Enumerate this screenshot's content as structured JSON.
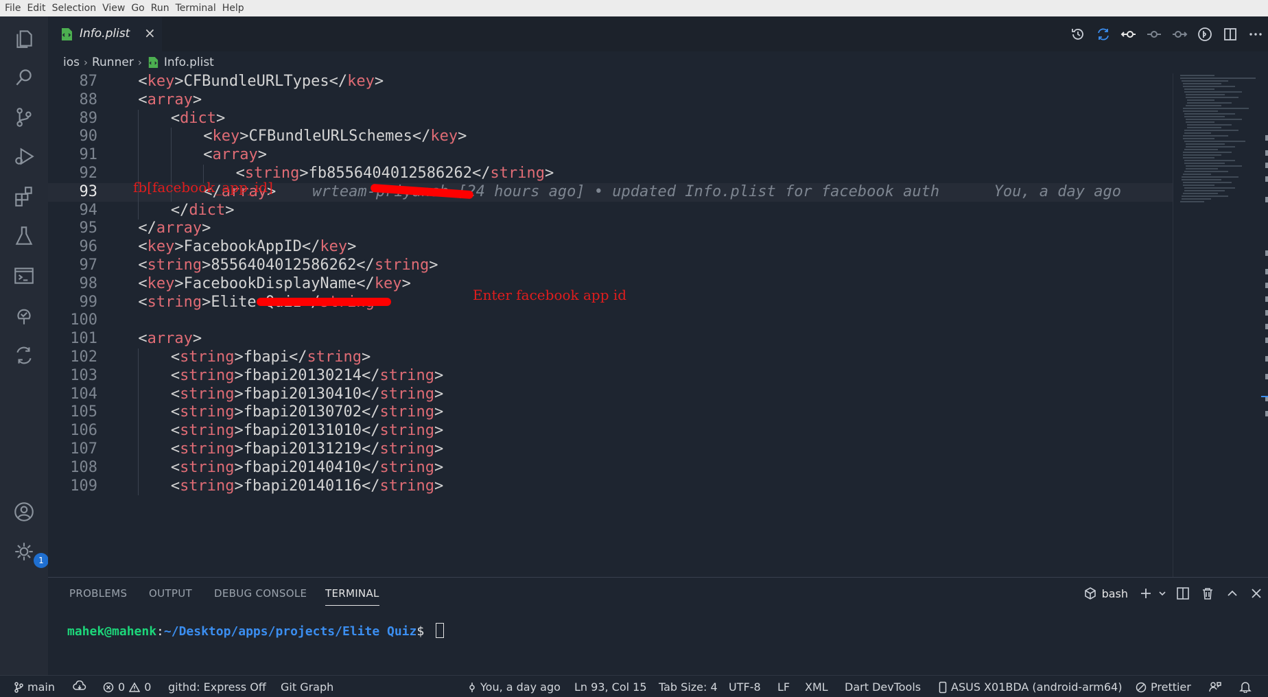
{
  "menu": [
    "File",
    "Edit",
    "Selection",
    "View",
    "Go",
    "Run",
    "Terminal",
    "Help"
  ],
  "tab": {
    "label": "Info.plist",
    "close": "×"
  },
  "breadcrumb": {
    "parts": [
      "ios",
      "Runner",
      "Info.plist"
    ]
  },
  "editor": {
    "lines": [
      {
        "n": "87",
        "indent": 1,
        "code": [
          [
            "t",
            "<"
          ],
          [
            "k",
            "key"
          ],
          [
            "t",
            ">CFBundleURLTypes</"
          ],
          [
            "k",
            "key"
          ],
          [
            "t",
            ">"
          ]
        ]
      },
      {
        "n": "88",
        "indent": 1,
        "code": [
          [
            "t",
            "<"
          ],
          [
            "k",
            "array"
          ],
          [
            "t",
            ">"
          ]
        ]
      },
      {
        "n": "89",
        "indent": 2,
        "code": [
          [
            "t",
            "<"
          ],
          [
            "k",
            "dict"
          ],
          [
            "t",
            ">"
          ]
        ]
      },
      {
        "n": "90",
        "indent": 3,
        "code": [
          [
            "t",
            "<"
          ],
          [
            "k",
            "key"
          ],
          [
            "t",
            ">CFBundleURLSchemes</"
          ],
          [
            "k",
            "key"
          ],
          [
            "t",
            ">"
          ]
        ]
      },
      {
        "n": "91",
        "indent": 3,
        "code": [
          [
            "t",
            "<"
          ],
          [
            "k",
            "array"
          ],
          [
            "t",
            ">"
          ]
        ]
      },
      {
        "n": "92",
        "indent": 4,
        "code": [
          [
            "t",
            "<"
          ],
          [
            "k",
            "string"
          ],
          [
            "t",
            ">fb8556404012586262</"
          ],
          [
            "k",
            "string"
          ],
          [
            "t",
            ">"
          ]
        ]
      },
      {
        "n": "93",
        "indent": 3,
        "current": true,
        "code": [
          [
            "t",
            "</"
          ],
          [
            "k",
            "array"
          ],
          [
            "t",
            ">"
          ]
        ],
        "blame": "    wrteam-priyansh [24 hours ago] • updated Info.plist for facebook auth      You, a day ago"
      },
      {
        "n": "94",
        "indent": 2,
        "code": [
          [
            "t",
            "</"
          ],
          [
            "k",
            "dict"
          ],
          [
            "t",
            ">"
          ]
        ]
      },
      {
        "n": "95",
        "indent": 1,
        "code": [
          [
            "t",
            "</"
          ],
          [
            "k",
            "array"
          ],
          [
            "t",
            ">"
          ]
        ]
      },
      {
        "n": "96",
        "indent": 1,
        "code": [
          [
            "t",
            "<"
          ],
          [
            "k",
            "key"
          ],
          [
            "t",
            ">FacebookAppID</"
          ],
          [
            "k",
            "key"
          ],
          [
            "t",
            ">"
          ]
        ]
      },
      {
        "n": "97",
        "indent": 1,
        "code": [
          [
            "t",
            "<"
          ],
          [
            "k",
            "string"
          ],
          [
            "t",
            ">8556404012586262</"
          ],
          [
            "k",
            "string"
          ],
          [
            "t",
            ">"
          ]
        ]
      },
      {
        "n": "98",
        "indent": 1,
        "code": [
          [
            "t",
            "<"
          ],
          [
            "k",
            "key"
          ],
          [
            "t",
            ">FacebookDisplayName</"
          ],
          [
            "k",
            "key"
          ],
          [
            "t",
            ">"
          ]
        ]
      },
      {
        "n": "99",
        "indent": 1,
        "code": [
          [
            "t",
            "<"
          ],
          [
            "k",
            "string"
          ],
          [
            "t",
            ">Elite Quiz</"
          ],
          [
            "k",
            "string"
          ],
          [
            "t",
            ">"
          ]
        ]
      },
      {
        "n": "100",
        "indent": 0,
        "code": []
      },
      {
        "n": "101",
        "indent": 1,
        "code": [
          [
            "t",
            "<"
          ],
          [
            "k",
            "array"
          ],
          [
            "t",
            ">"
          ]
        ]
      },
      {
        "n": "102",
        "indent": 2,
        "code": [
          [
            "t",
            "<"
          ],
          [
            "k",
            "string"
          ],
          [
            "t",
            ">fbapi</"
          ],
          [
            "k",
            "string"
          ],
          [
            "t",
            ">"
          ]
        ]
      },
      {
        "n": "103",
        "indent": 2,
        "code": [
          [
            "t",
            "<"
          ],
          [
            "k",
            "string"
          ],
          [
            "t",
            ">fbapi20130214</"
          ],
          [
            "k",
            "string"
          ],
          [
            "t",
            ">"
          ]
        ]
      },
      {
        "n": "104",
        "indent": 2,
        "code": [
          [
            "t",
            "<"
          ],
          [
            "k",
            "string"
          ],
          [
            "t",
            ">fbapi20130410</"
          ],
          [
            "k",
            "string"
          ],
          [
            "t",
            ">"
          ]
        ]
      },
      {
        "n": "105",
        "indent": 2,
        "code": [
          [
            "t",
            "<"
          ],
          [
            "k",
            "string"
          ],
          [
            "t",
            ">fbapi20130702</"
          ],
          [
            "k",
            "string"
          ],
          [
            "t",
            ">"
          ]
        ]
      },
      {
        "n": "106",
        "indent": 2,
        "code": [
          [
            "t",
            "<"
          ],
          [
            "k",
            "string"
          ],
          [
            "t",
            ">fbapi20131010</"
          ],
          [
            "k",
            "string"
          ],
          [
            "t",
            ">"
          ]
        ]
      },
      {
        "n": "107",
        "indent": 2,
        "code": [
          [
            "t",
            "<"
          ],
          [
            "k",
            "string"
          ],
          [
            "t",
            ">fbapi20131219</"
          ],
          [
            "k",
            "string"
          ],
          [
            "t",
            ">"
          ]
        ]
      },
      {
        "n": "108",
        "indent": 2,
        "code": [
          [
            "t",
            "<"
          ],
          [
            "k",
            "string"
          ],
          [
            "t",
            ">fbapi20140410</"
          ],
          [
            "k",
            "string"
          ],
          [
            "t",
            ">"
          ]
        ]
      },
      {
        "n": "109",
        "indent": 2,
        "code": [
          [
            "t",
            "<"
          ],
          [
            "k",
            "string"
          ],
          [
            "t",
            ">fbapi20140116</"
          ],
          [
            "k",
            "string"
          ],
          [
            "t",
            ">"
          ]
        ]
      }
    ]
  },
  "annotations": {
    "line92": "fb[facebook_app_id]",
    "line97": "Enter facebook app id"
  },
  "panel": {
    "tabs": [
      "PROBLEMS",
      "OUTPUT",
      "DEBUG CONSOLE",
      "TERMINAL"
    ],
    "shell": "bash",
    "terminal": {
      "user": "mahek@mahenk",
      "path": "~/Desktop/apps/projects/Elite Quiz",
      "prompt": "$ "
    }
  },
  "status": {
    "branch": "main",
    "errors": "0",
    "warnings": "0",
    "githd": "githd: Express Off",
    "gitgraph": "Git Graph",
    "blame": "You, a day ago",
    "position": "Ln 93, Col 15",
    "tabsize": "Tab Size: 4",
    "encoding": "UTF-8",
    "eol": "LF",
    "language": "XML",
    "devtools": "Dart DevTools",
    "device": "ASUS X01BDA (android-arm64)",
    "prettier": "Prettier"
  },
  "settings_badge": "1",
  "colors": {
    "tag": "#e06c75",
    "annotation": "#e11d1d",
    "terminal_user": "#1dd67a",
    "terminal_path": "#3b8ef0",
    "accent": "#1f6fd0"
  }
}
